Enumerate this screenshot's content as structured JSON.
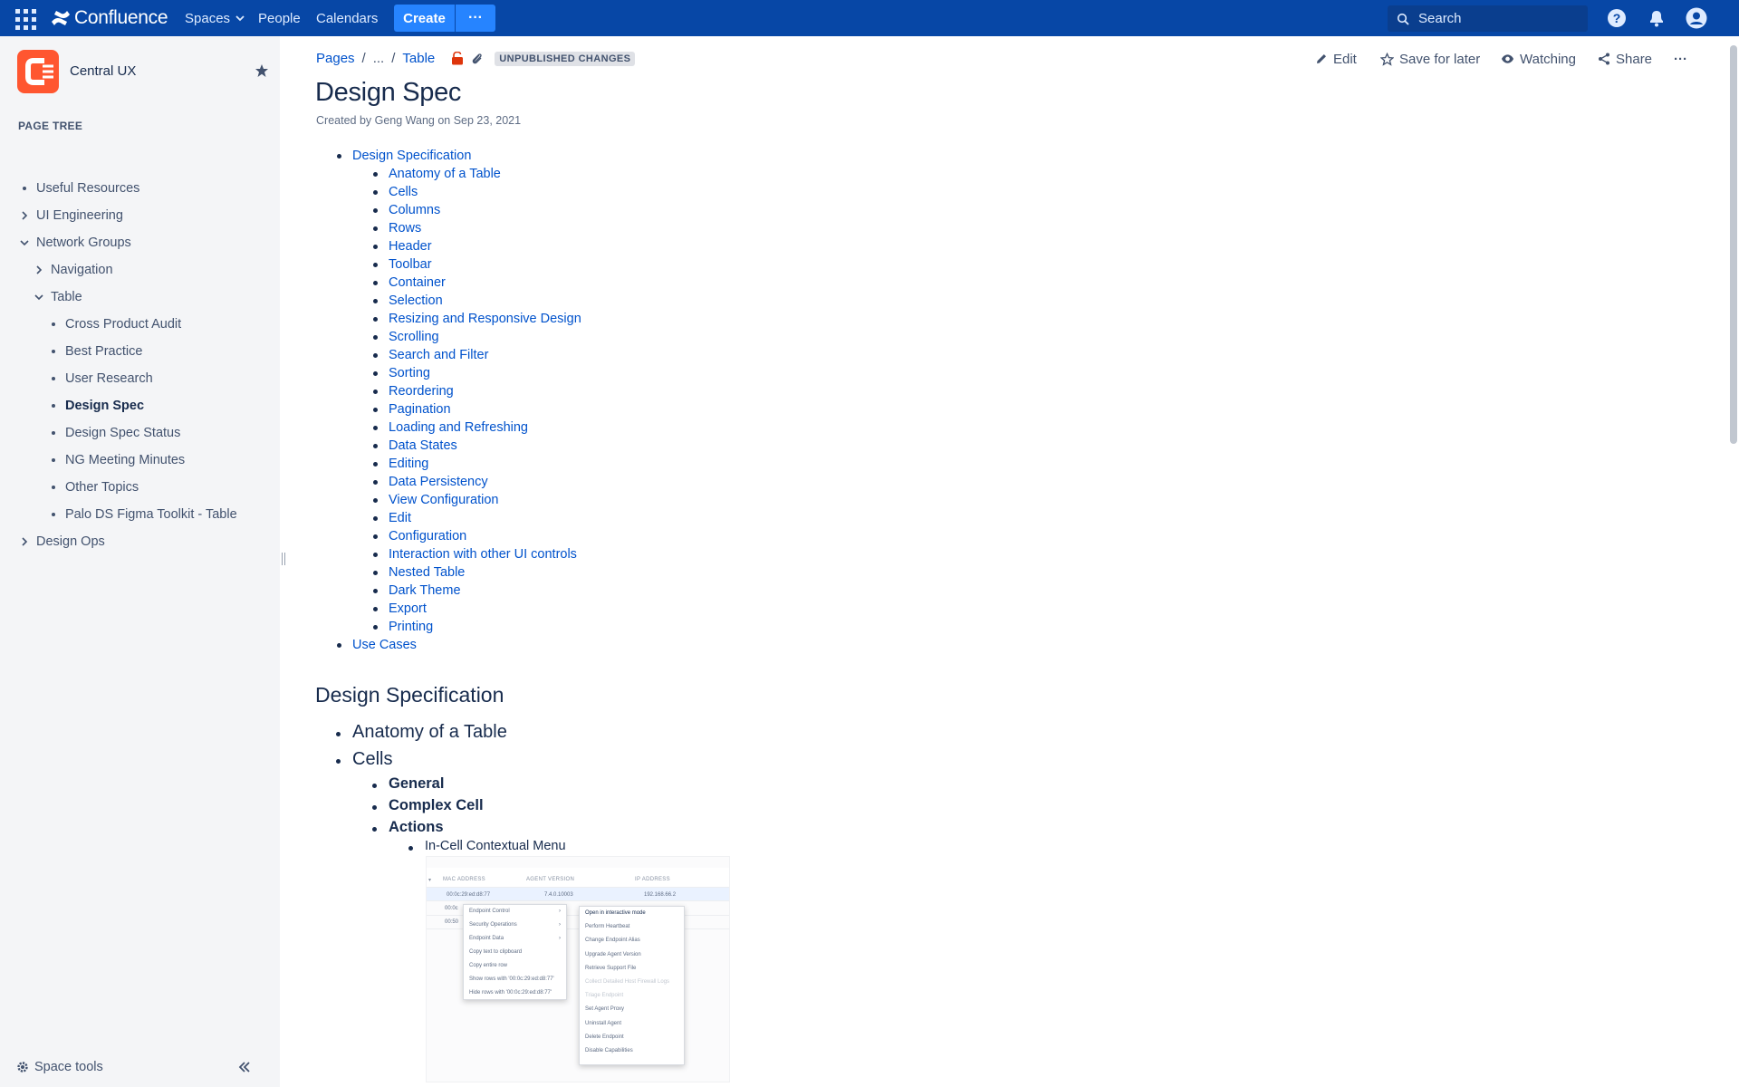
{
  "topnav": {
    "logo_text": "Confluence",
    "items": [
      {
        "label": "Spaces",
        "dropdown": true
      },
      {
        "label": "People"
      },
      {
        "label": "Calendars"
      }
    ],
    "create_label": "Create",
    "more_label": "···",
    "search_placeholder": "Search",
    "bg_color": "#0747a6",
    "accent_color": "#2684ff"
  },
  "sidebar": {
    "space_name": "Central UX",
    "page_tree_title": "PAGE TREE",
    "tree": [
      {
        "label": "Useful Resources",
        "marker": "dot",
        "level": 0
      },
      {
        "label": "UI Engineering",
        "marker": "chevron-right",
        "level": 0
      },
      {
        "label": "Network Groups",
        "marker": "chevron-down",
        "level": 0
      },
      {
        "label": "Navigation",
        "marker": "chevron-right",
        "level": 1
      },
      {
        "label": "Table",
        "marker": "chevron-down",
        "level": 1
      },
      {
        "label": "Cross Product Audit",
        "marker": "dot",
        "level": 2
      },
      {
        "label": "Best Practice",
        "marker": "dot",
        "level": 2
      },
      {
        "label": "User Research",
        "marker": "dot",
        "level": 2
      },
      {
        "label": "Design Spec",
        "marker": "dot",
        "level": 2,
        "current": true
      },
      {
        "label": "Design Spec Status",
        "marker": "dot",
        "level": 2
      },
      {
        "label": "NG Meeting Minutes",
        "marker": "dot",
        "level": 2
      },
      {
        "label": "Other Topics",
        "marker": "dot",
        "level": 2
      },
      {
        "label": "Palo DS Figma Toolkit - Table",
        "marker": "dot",
        "level": 2
      },
      {
        "label": "Design Ops",
        "marker": "chevron-right",
        "level": 0
      }
    ],
    "space_tools_label": "Space tools",
    "collapse_label": "«"
  },
  "breadcrumb": {
    "pages": "Pages",
    "ellipsis": "...",
    "table": "Table",
    "unpublished": "UNPUBLISHED CHANGES"
  },
  "actions": {
    "edit": "Edit",
    "save_for_later": "Save for later",
    "watching": "Watching",
    "share": "Share",
    "more": "···"
  },
  "page": {
    "title": "Design Spec",
    "byline": "Created by Geng Wang on Sep 23, 2021"
  },
  "toc": {
    "top": [
      "Design Specification",
      "Use Cases"
    ],
    "sub": [
      "Anatomy of a Table",
      "Cells",
      "Columns",
      "Rows",
      "Header",
      "Toolbar",
      "Container",
      "Selection",
      "Resizing and Responsive Design",
      "Scrolling",
      "Search and Filter",
      "Sorting",
      "Reordering",
      "Pagination",
      "Loading and Refreshing",
      "Data States",
      "Editing",
      "Data Persistency",
      "View Configuration",
      "Edit",
      "Configuration",
      "Interaction with other UI controls",
      "Nested Table",
      "Dark Theme",
      "Export",
      "Printing"
    ]
  },
  "content": {
    "heading": "Design Specification",
    "h3": [
      "Anatomy of a Table",
      "Cells"
    ],
    "h4": [
      "General",
      "Complex Cell",
      "Actions"
    ],
    "p": [
      "In-Cell Contextual Menu"
    ]
  },
  "embed": {
    "headers": [
      "MAC ADDRESS",
      "AGENT VERSION",
      "IP ADDRESS"
    ],
    "cells": [
      "00:0c:29:ed:d8:77",
      "7.4.0.10003",
      "192.168.66.2",
      "00:0c",
      "00:50"
    ],
    "menu1": [
      "Endpoint Control",
      "Security Operations",
      "Endpoint Data",
      "Copy text to clipboard",
      "Copy entire row",
      "Show rows with '00:0c:29:ed:d8:77'",
      "Hide rows with '00:0c:29:ed:d8:77'"
    ],
    "menu2": [
      "Open in interactive mode",
      "Perform Heartbeat",
      "Change Endpoint Alias",
      "Upgrade Agent Version",
      "Retrieve Support File",
      "Collect Detailed Host Firewall Logs",
      "Triage Endpoint",
      "Set Agent Proxy",
      "Uninstall Agent",
      "Delete Endpoint",
      "Disable Capabilities"
    ]
  }
}
